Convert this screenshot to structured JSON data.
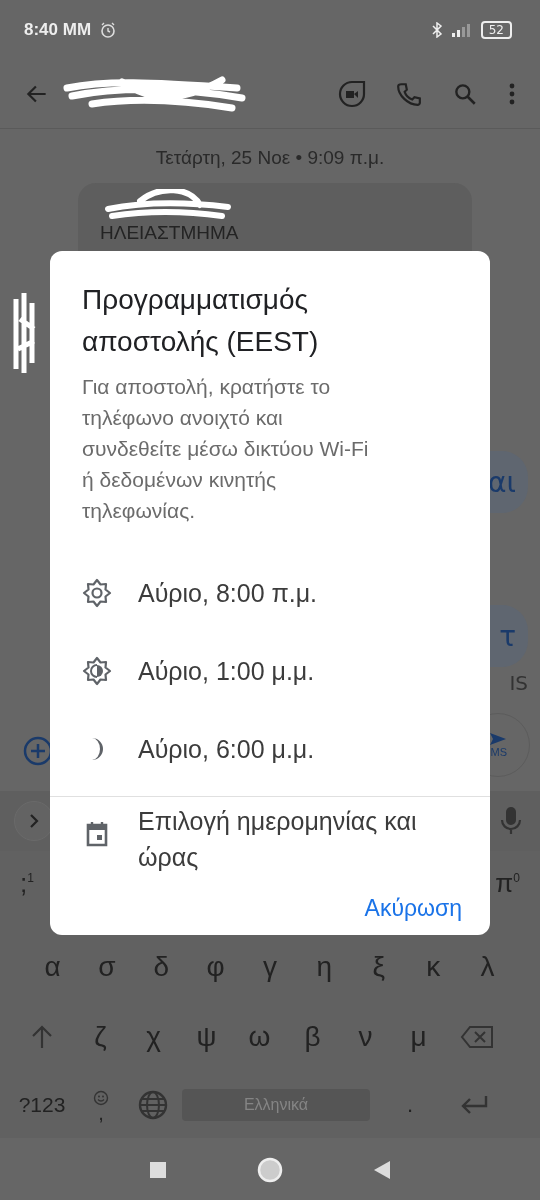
{
  "status_bar": {
    "time": "8:40 MM",
    "battery": "52"
  },
  "date_header": "Τετάρτη, 25 Νοε • 9:09 π.μ.",
  "message": {
    "text": "ΗΛΕΙΑΣΤΜΗΜΑ"
  },
  "side_bubbles": [
    {
      "text": "αι"
    },
    {
      "text": "τ"
    }
  ],
  "side_label": "IS",
  "send_button": {
    "label": "MS"
  },
  "dialog": {
    "title": "Προγραμματισμός αποστολής (EEST)",
    "description": "Για αποστολή, κρατήστε το τηλέφωνο ανοιχτό και συνδεθείτε μέσω δικτύου Wi-Fi ή δεδομένων κινητής τηλεφωνίας.",
    "options": [
      {
        "kind": "morning",
        "label": "Αύριο, 8:00 π.μ."
      },
      {
        "kind": "afternoon",
        "label": "Αύριο, 1:00 μ.μ."
      },
      {
        "kind": "evening",
        "label": "Αύριο, 6:00 μ.μ."
      },
      {
        "kind": "custom",
        "label": "Επιλογή ημερομηνίας και ώρας"
      }
    ],
    "cancel": "Ακύρωση"
  },
  "keyboard": {
    "row_1_edges": [
      {
        "key": ";",
        "hint": "1"
      },
      {
        "key": "π",
        "hint": "0"
      }
    ],
    "row_2": [
      "α",
      "σ",
      "δ",
      "φ",
      "γ",
      "η",
      "ξ",
      "κ",
      "λ"
    ],
    "row_3": [
      "ζ",
      "χ",
      "ψ",
      "ω",
      "β",
      "ν",
      "μ"
    ],
    "symbols_key": "?123",
    "comma_key": ",",
    "space_label": "Ελληνικά",
    "period_key": "."
  }
}
